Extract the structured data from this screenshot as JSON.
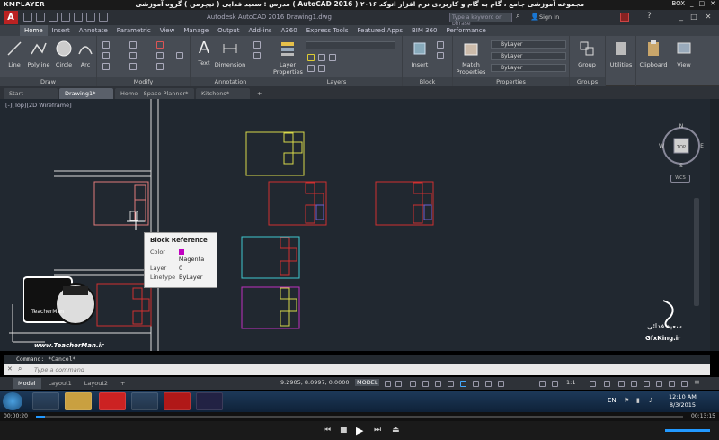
{
  "kmplayer": {
    "logo": "KMPLAYER",
    "title": "مجموعه آموزشی جامع ، گام به گام و کاربردی نرم افزار اتوکد ۲۰۱۶ ( AutoCAD 2016 )  مدرس : سعید فدایی ( تیچرمن ) گروه آموزشی پادشاه گرافیست ها",
    "top_right": "BOX",
    "time_elapsed": "00:00:20",
    "time_total": "00:13:15"
  },
  "acad": {
    "window_title": "Autodesk AutoCAD 2016   Drawing1.dwg",
    "search_placeholder": "Type a keyword or phrase",
    "sign_in": "Sign In",
    "ribbon_tabs": [
      "Home",
      "Insert",
      "Annotate",
      "Parametric",
      "View",
      "Manage",
      "Output",
      "Add-ins",
      "A360",
      "Express Tools",
      "Featured Apps",
      "BIM 360",
      "Performance"
    ],
    "panels": {
      "draw": {
        "label": "Draw",
        "tools": [
          "Line",
          "Polyline",
          "Circle",
          "Arc"
        ]
      },
      "modify": {
        "label": "Modify"
      },
      "annotation": {
        "label": "Annotation",
        "tools": [
          "Text",
          "Dimension"
        ]
      },
      "layers": {
        "label": "Layers",
        "tool": "Layer Properties"
      },
      "block": {
        "label": "Block",
        "tool": "Insert"
      },
      "properties": {
        "label": "Properties",
        "tool": "Match Properties",
        "dropdowns": [
          "ByLayer",
          "ByLayer",
          "ByLayer"
        ]
      },
      "groups": {
        "label": "Groups",
        "tool": "Group"
      },
      "utilities": {
        "label": "Utilities"
      },
      "clipboard": {
        "label": "Clipboard"
      },
      "view": {
        "label": "View"
      }
    },
    "file_tabs": [
      "Start",
      "Drawing1*",
      "Home - Space Planner*",
      "Kitchens*"
    ],
    "viewport_label": "[-][Top][2D Wireframe]",
    "viewcube": {
      "face": "TOP",
      "n": "N",
      "s": "S",
      "e": "E",
      "w": "W",
      "wcs": "WCS"
    },
    "tooltip": {
      "title": "Block Reference",
      "rows": [
        {
          "key": "Color",
          "value": "Magenta"
        },
        {
          "key": "Layer",
          "value": "0"
        },
        {
          "key": "Linetype",
          "value": "ByLayer"
        }
      ]
    },
    "command_history": "Command: *Cancel*",
    "command_placeholder": "Type a command",
    "layout_tabs": [
      "Model",
      "Layout1",
      "Layout2"
    ],
    "coordinates": "9.2905, 8.0997, 0.0000",
    "model_button": "MODEL",
    "scale": "1:1"
  },
  "watermarks": {
    "left_url": "www.TeacherMan.ir",
    "left_badge": "TeacherMan",
    "right_name": "سعید فدائی",
    "right_url": "GfxKing.ir"
  },
  "taskbar": {
    "lang": "EN",
    "time": "12:10 AM",
    "date": "8/3/2015"
  }
}
